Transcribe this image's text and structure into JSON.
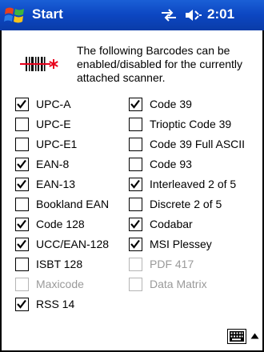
{
  "taskbar": {
    "start_label": "Start",
    "time": "2:01",
    "icons": [
      "windows-flag-icon",
      "connectivity-sync-icon",
      "speaker-icon"
    ]
  },
  "intro_text": "The following Barcodes can be enabled/disabled for the currently attached scanner.",
  "colors": {
    "titlebar": "#0c46c1",
    "barcode_mark": "#e8001c",
    "disabled_text": "#9a9a9a"
  },
  "symbologies": {
    "left": [
      {
        "label": "UPC-A",
        "checked": true,
        "enabled": true
      },
      {
        "label": "UPC-E",
        "checked": false,
        "enabled": true
      },
      {
        "label": "UPC-E1",
        "checked": false,
        "enabled": true
      },
      {
        "label": "EAN-8",
        "checked": true,
        "enabled": true
      },
      {
        "label": "EAN-13",
        "checked": true,
        "enabled": true
      },
      {
        "label": "Bookland EAN",
        "checked": false,
        "enabled": true
      },
      {
        "label": "Code 128",
        "checked": true,
        "enabled": true
      },
      {
        "label": "UCC/EAN-128",
        "checked": true,
        "enabled": true
      },
      {
        "label": "ISBT 128",
        "checked": false,
        "enabled": true
      },
      {
        "label": "Maxicode",
        "checked": false,
        "enabled": false
      },
      {
        "label": "RSS 14",
        "checked": true,
        "enabled": true
      }
    ],
    "right": [
      {
        "label": "Code 39",
        "checked": true,
        "enabled": true
      },
      {
        "label": "Trioptic Code 39",
        "checked": false,
        "enabled": true
      },
      {
        "label": "Code 39 Full ASCII",
        "checked": false,
        "enabled": true
      },
      {
        "label": "Code 93",
        "checked": false,
        "enabled": true
      },
      {
        "label": "Interleaved 2 of 5",
        "checked": true,
        "enabled": true
      },
      {
        "label": "Discrete 2 of 5",
        "checked": false,
        "enabled": true
      },
      {
        "label": "Codabar",
        "checked": true,
        "enabled": true
      },
      {
        "label": "MSI Plessey",
        "checked": true,
        "enabled": true
      },
      {
        "label": "PDF 417",
        "checked": false,
        "enabled": false
      },
      {
        "label": "Data Matrix",
        "checked": false,
        "enabled": false
      }
    ]
  },
  "input_panel": {
    "icon": "keyboard-icon",
    "arrow_icon": "arrow-up-icon"
  }
}
